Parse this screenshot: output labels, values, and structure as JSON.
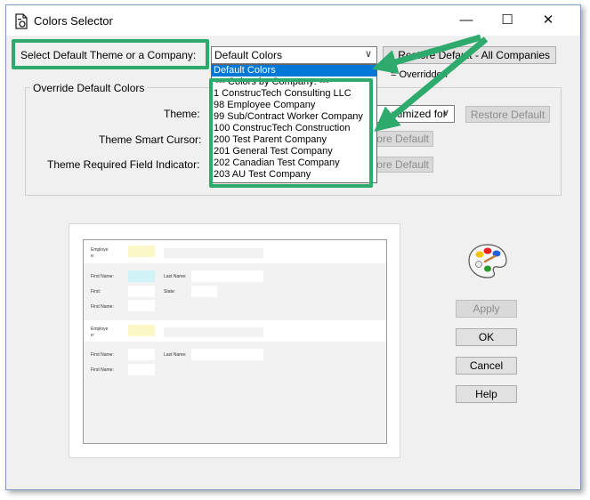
{
  "window": {
    "title": "Colors Selector",
    "minimize_glyph": "—",
    "maximize_glyph": "☐",
    "close_glyph": "✕"
  },
  "top": {
    "select_label": "Select Default Theme or a Company:",
    "combo_value": "Default Colors",
    "restore_all_label": "Restore Default - All Companies",
    "overridden_legend": "= Overridden"
  },
  "override": {
    "group_title": "Override Default Colors",
    "theme_label": "Theme:",
    "theme_value": "(optimized for",
    "smart_cursor_label": "Theme Smart Cursor:",
    "required_field_label": "Theme Required Field Indicator:",
    "restore_default_label": "Restore Default",
    "restore_default_partial": "ore Default"
  },
  "dropdown": {
    "items": [
      "Default Colors",
      "---  Colors by Company:  ---",
      "1    ConstrucTech Consulting LLC",
      "98   Employee Company",
      "99   Sub/Contract Worker Company",
      "100  ConstrucTech Construction",
      "200  Test Parent Company",
      "201  General Test Company",
      "202  Canadian Test Company",
      "203  AU Test Company"
    ]
  },
  "preview": {
    "employee": "Employe",
    "employee2": "e:",
    "first_name": "First Name:",
    "last_name": "Last Name:",
    "first": "First:",
    "state": "State:"
  },
  "buttons": {
    "apply": "Apply",
    "ok": "OK",
    "cancel": "Cancel",
    "help": "Help"
  },
  "colors": {
    "highlight": "#2eaa6d",
    "selection": "#0078d7",
    "required_indicator": "#fbf7c6",
    "smart_cursor": "#cff3f6"
  },
  "icons": {
    "app": "document-gear-icon",
    "palette": "paint-palette-icon"
  }
}
